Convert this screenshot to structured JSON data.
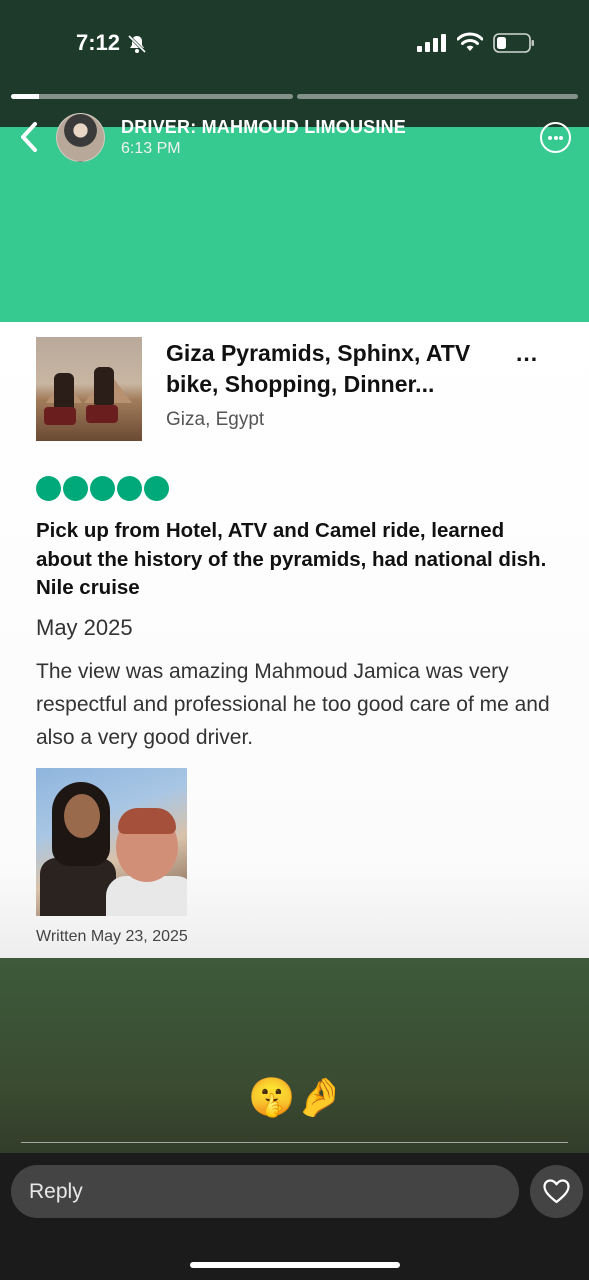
{
  "status_bar": {
    "time": "7:12",
    "icons": [
      "bell-slash-icon",
      "signal-bars-icon",
      "wifi-icon",
      "battery-icon"
    ],
    "battery_level": 0.25
  },
  "story": {
    "progress": [
      0.1,
      0.0
    ],
    "poster_name": "DRIVER: MAHMOUD LIMOUSINE",
    "posted_time": "6:13 PM"
  },
  "review": {
    "tour_title": "Giza Pyramids, Sphinx, ATV bike, Shopping, Dinner...",
    "more_label": "...",
    "location": "Giza, Egypt",
    "rating": 5,
    "rating_color": "#00a97a",
    "title": "Pick up from Hotel, ATV and Camel ride, learned about the history of the pyramids, had national dish. Nile cruise",
    "date": "May 2025",
    "body": "The view was amazing Mahmoud Jamica was very respectful and professional he too good care of me and also a very good driver.",
    "written": "Written May 23, 2025"
  },
  "reactions": [
    "🤫",
    "🤌"
  ],
  "reply": {
    "placeholder": "Reply"
  },
  "colors": {
    "story_green": "#36c990",
    "top_band": "#1d3a2b",
    "reply_field": "#444444"
  }
}
